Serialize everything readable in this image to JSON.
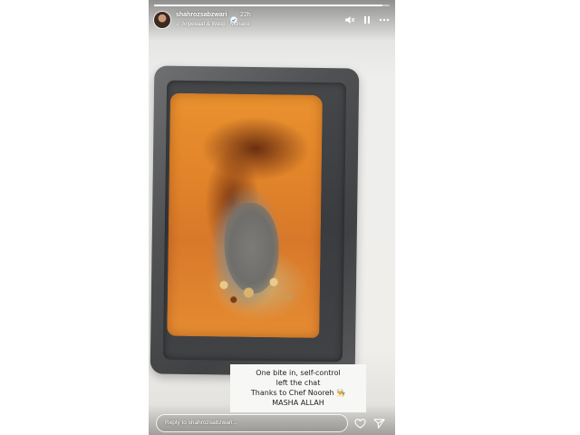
{
  "story": {
    "progress": 0.97,
    "user": {
      "username": "shahrozsabzwari",
      "verified": true,
      "time": "22h"
    },
    "music": {
      "icon": "music-note-icon",
      "track": "Anpeeaat & Wasp · Monaco"
    },
    "controls": [
      "mute-icon",
      "pause-icon",
      "more-icon"
    ],
    "photo_subject": "cake-in-loaf-pan",
    "caption": {
      "line1": "One bite in, self-control",
      "line2": "left the chat",
      "line3": "Thanks to Chef Nooreh",
      "line3_emoji": "👨‍🍳",
      "line4": "MASHA ALLAH"
    },
    "reply": {
      "placeholder": "Reply to shahrozsabzwari..."
    },
    "actions": [
      "heart-icon",
      "send-icon"
    ]
  }
}
